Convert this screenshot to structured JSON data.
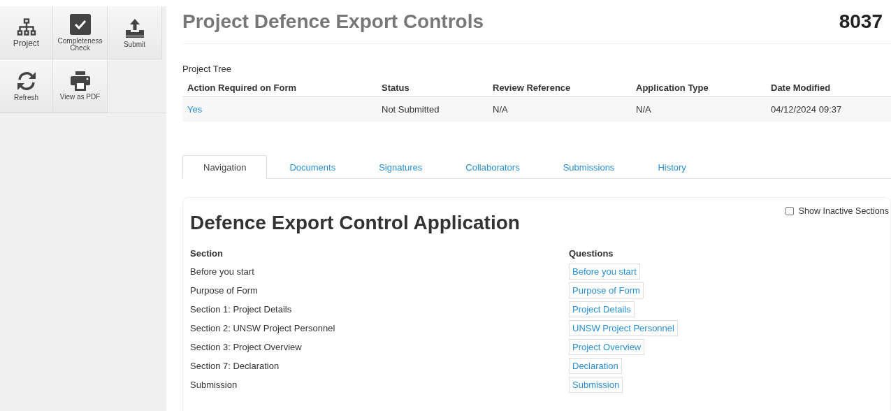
{
  "toolbar": [
    {
      "label": "Project",
      "kind": "tree"
    },
    {
      "label": "Completeness Check",
      "kind": "check"
    },
    {
      "label": "Submit",
      "kind": "upload"
    },
    {
      "label": "Refresh",
      "kind": "refresh"
    },
    {
      "label": "View as PDF",
      "kind": "print"
    }
  ],
  "header": {
    "title": "Project Defence Export Controls",
    "number": "8037"
  },
  "project_tree": {
    "caption": "Project Tree",
    "columns": [
      "Action Required on Form",
      "Status",
      "Review Reference",
      "Application Type",
      "Date Modified"
    ],
    "rows": [
      {
        "cells": [
          "Yes",
          "Not Submitted",
          "N/A",
          "N/A",
          "04/12/2024 09:37"
        ]
      }
    ]
  },
  "tabs": [
    {
      "label": "Navigation",
      "selected": true
    },
    {
      "label": "Documents",
      "selected": false
    },
    {
      "label": "Signatures",
      "selected": false
    },
    {
      "label": "Collaborators",
      "selected": false
    },
    {
      "label": "Submissions",
      "selected": false
    },
    {
      "label": "History",
      "selected": false
    }
  ],
  "form": {
    "title": "Defence Export Control Application",
    "show_inactive": {
      "label": "Show Inactive Sections",
      "checked": false
    },
    "columns": [
      "Section",
      "Questions"
    ],
    "sections": [
      {
        "section": "Before you start",
        "questions": "Before you start"
      },
      {
        "section": "Purpose of Form",
        "questions": "Purpose of Form"
      },
      {
        "section": "Section 1: Project Details",
        "questions": "Project Details"
      },
      {
        "section": "Section 2: UNSW Project Personnel",
        "questions": "UNSW Project Personnel"
      },
      {
        "section": "Section 3: Project Overview",
        "questions": "Project Overview"
      },
      {
        "section": "Section 7: Declaration",
        "questions": "Declaration"
      },
      {
        "section": "Submission",
        "questions": "Submission"
      }
    ]
  }
}
